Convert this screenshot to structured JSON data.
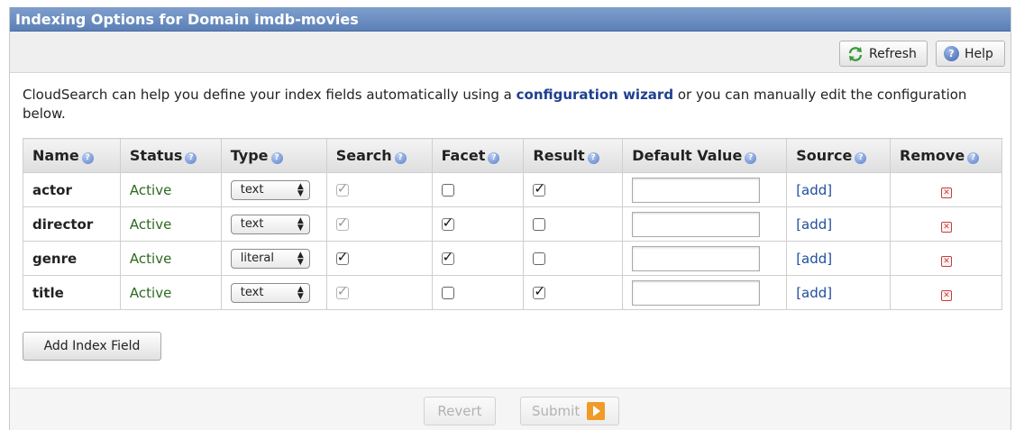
{
  "title": "Indexing Options for Domain imdb-movies",
  "toolbar": {
    "refresh_label": "Refresh",
    "help_label": "Help"
  },
  "intro": {
    "before": "CloudSearch can help you define your index fields automatically using a ",
    "link": "configuration wizard",
    "after": " or you can manually edit the configuration below."
  },
  "columns": [
    "Name",
    "Status",
    "Type",
    "Search",
    "Facet",
    "Result",
    "Default Value",
    "Source",
    "Remove"
  ],
  "rows": [
    {
      "name": "actor",
      "status": "Active",
      "type": "text",
      "search": "checked-disabled",
      "facet": "unchecked",
      "result": "checked",
      "default_value": "",
      "source": "[add]"
    },
    {
      "name": "director",
      "status": "Active",
      "type": "text",
      "search": "checked-disabled",
      "facet": "checked",
      "result": "unchecked",
      "default_value": "",
      "source": "[add]"
    },
    {
      "name": "genre",
      "status": "Active",
      "type": "literal",
      "search": "checked",
      "facet": "checked",
      "result": "unchecked",
      "default_value": "",
      "source": "[add]"
    },
    {
      "name": "title",
      "status": "Active",
      "type": "text",
      "search": "checked-disabled",
      "facet": "unchecked",
      "result": "checked",
      "default_value": "",
      "source": "[add]"
    }
  ],
  "add_field_label": "Add Index Field",
  "footer": {
    "revert_label": "Revert",
    "submit_label": "Submit"
  },
  "colors": {
    "title_bar": "#5b80b8",
    "status_active": "#2c6a1f",
    "link": "#1f4e9e",
    "submit_icon": "#f09a28"
  },
  "icons": {
    "refresh": "refresh-icon",
    "help": "help-icon",
    "column_help": "question-icon",
    "remove": "remove-icon",
    "submit": "play-icon"
  }
}
